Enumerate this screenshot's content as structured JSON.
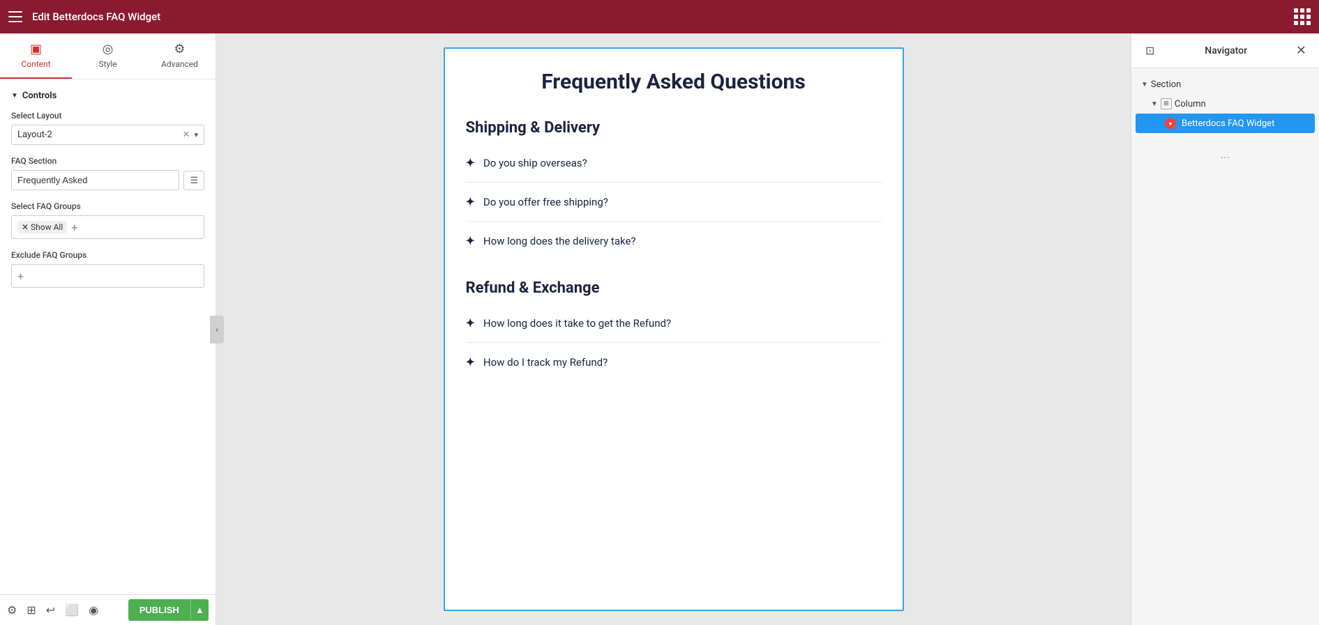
{
  "topbar": {
    "title": "Edit Betterdocs FAQ Widget",
    "hamburger_label": "menu",
    "grid_label": "apps"
  },
  "tabs": [
    {
      "id": "content",
      "label": "Content",
      "icon": "⬡",
      "active": true
    },
    {
      "id": "style",
      "label": "Style",
      "icon": "🎨",
      "active": false
    },
    {
      "id": "advanced",
      "label": "Advanced",
      "icon": "⚙",
      "active": false
    }
  ],
  "controls": {
    "section_label": "Controls",
    "select_layout_label": "Select Layout",
    "select_layout_value": "Layout-2",
    "faq_section_label": "FAQ Section",
    "faq_section_value": "Frequently Asked",
    "select_faq_groups_label": "Select FAQ Groups",
    "faq_groups_tags": [
      "Show All"
    ],
    "exclude_faq_groups_label": "Exclude FAQ Groups"
  },
  "faq_widget": {
    "main_title": "Frequently Asked Questions",
    "sections": [
      {
        "title": "Shipping & Delivery",
        "questions": [
          "Do you ship overseas?",
          "Do you offer free shipping?",
          "How long does the delivery take?"
        ]
      },
      {
        "title": "Refund & Exchange",
        "questions": [
          "How long does it take to get the Refund?",
          "How do I track my Refund?"
        ]
      }
    ]
  },
  "navigator": {
    "title": "Navigator",
    "items": [
      {
        "id": "section",
        "label": "Section",
        "level": 0
      },
      {
        "id": "column",
        "label": "Column",
        "level": 1
      },
      {
        "id": "betterdocs-faq",
        "label": "Betterdocs FAQ Widget",
        "level": 2,
        "active": true
      }
    ],
    "ellipsis": "..."
  },
  "bottom_toolbar": {
    "publish_label": "PUBLISH",
    "icons": [
      "settings",
      "layers",
      "history",
      "responsive",
      "eye"
    ]
  }
}
